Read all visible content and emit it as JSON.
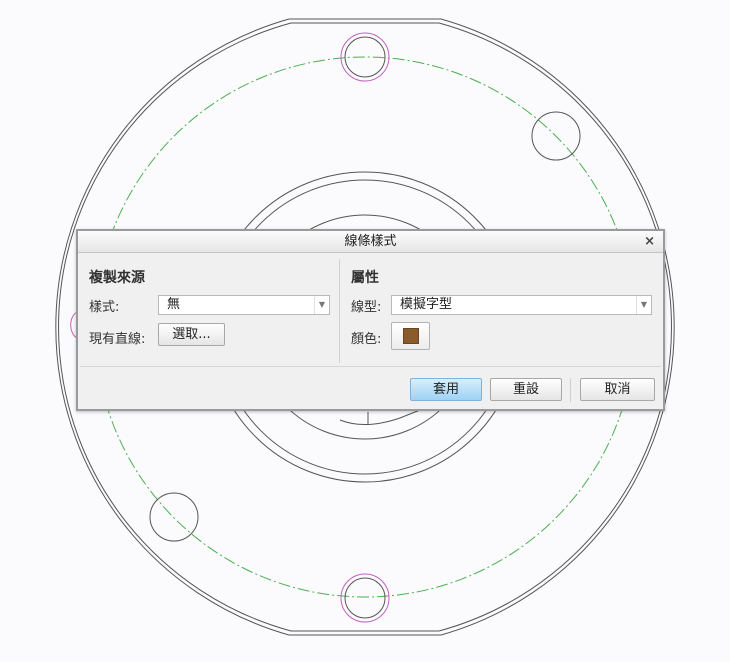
{
  "dialog": {
    "title": "線條樣式",
    "close_label": "×",
    "copy_source": {
      "heading": "複製來源",
      "style_label": "樣式:",
      "style_value": "無",
      "existing_line_label": "現有直線:",
      "select_button": "選取..."
    },
    "attributes": {
      "heading": "屬性",
      "line_type_label": "線型:",
      "line_type_value": "模擬字型",
      "color_label": "顏色:",
      "color_value": "#8b5a2b"
    },
    "buttons": {
      "apply": "套用",
      "reset": "重設",
      "cancel": "取消"
    }
  },
  "drawing": {
    "outline_color": "#555555",
    "centerline_color": "#4caf50",
    "highlight_color": "#c060c0"
  }
}
